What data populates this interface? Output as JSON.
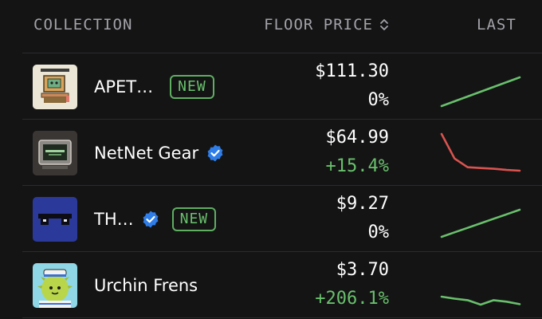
{
  "header": {
    "collection_label": "COLLECTION",
    "floor_price_label": "FLOOR PRICE",
    "last_label": "LAST",
    "sort_icon": "sort-up-down-icon"
  },
  "colors": {
    "background": "#141415",
    "positive": "#69c06c",
    "negative": "#d9534f",
    "verified": "#2f7de8",
    "muted": "#a2a2a8"
  },
  "rows": [
    {
      "name": "APET…",
      "verified": false,
      "badge": "NEW",
      "price": "$111.30",
      "change": "0%",
      "trend": "up",
      "spark": [
        0,
        1,
        2,
        3,
        4,
        5,
        6
      ]
    },
    {
      "name": "NetNet Gear",
      "verified": true,
      "badge": "",
      "price": "$64.99",
      "change": "+15.4%",
      "trend": "down",
      "spark": [
        10,
        3.5,
        1.2,
        1.0,
        0.8,
        0.5,
        0.3
      ]
    },
    {
      "name": "TH…",
      "verified": true,
      "badge": "NEW",
      "price": "$9.27",
      "change": "0%",
      "trend": "up",
      "spark": [
        0,
        1,
        2,
        3,
        4,
        5,
        6
      ]
    },
    {
      "name": "Urchin Frens",
      "verified": false,
      "badge": "",
      "price": "$3.70",
      "change": "+206.1%",
      "trend": "up",
      "spark": [
        5.0,
        4.6,
        4.3,
        3.4,
        4.3,
        4.0,
        3.5
      ]
    }
  ]
}
